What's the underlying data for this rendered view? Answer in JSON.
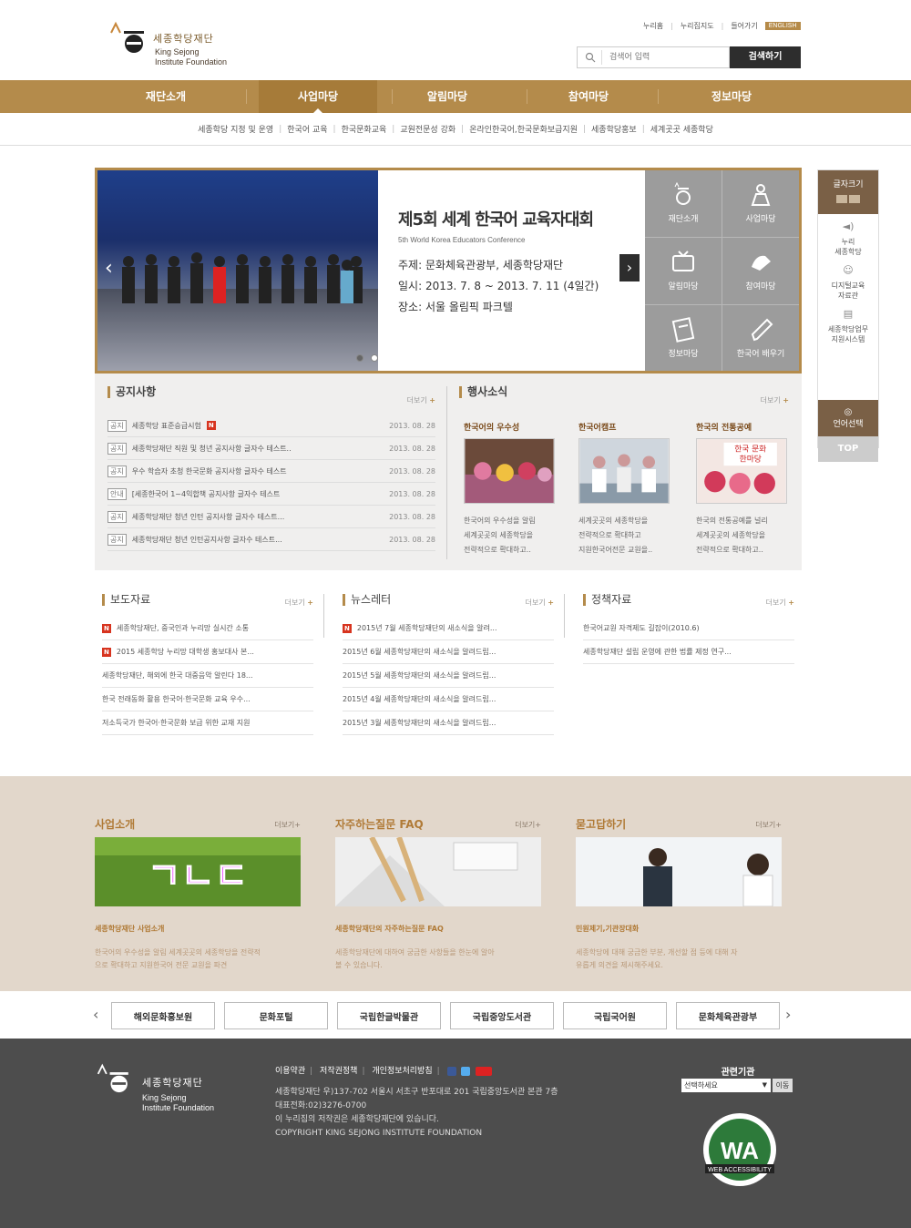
{
  "header": {
    "logo_ko": "세종학당재단",
    "logo_en1": "King Sejong",
    "logo_en2": "Institute Foundation",
    "util": [
      "누리홈",
      "누리집지도",
      "들어가기"
    ],
    "english": "ENGLISH",
    "search_placeholder": "검색어 입력",
    "search_button": "검색하기"
  },
  "gnb": [
    "재단소개",
    "사업마당",
    "알림마당",
    "참여마당",
    "정보마당"
  ],
  "sub_menu": [
    "세종학당 지정 및 운영",
    "한국어 교육",
    "한국문화교육",
    "교원전문성 강화",
    "온라인한국어,한국문화보급지원",
    "세종학당홍보",
    "세계곳곳 세종학당"
  ],
  "visual": {
    "title": "제5회 세계 한국어 교육자대회",
    "subtitle": "5th World Korea Educators Conference",
    "line1": "주제: 문화체육관광부, 세종학당재단",
    "line2": "일시: 2013. 7. 8 ~ 2013. 7. 11 (4일간)",
    "line3": "장소: 서울 올림픽 파크텔",
    "quick": [
      "재단소개",
      "사업마당",
      "알림마당",
      "참여마당",
      "정보마당",
      "한국어 배우기"
    ]
  },
  "notice": {
    "title": "공지사항",
    "more": "더보기",
    "rows": [
      {
        "tag": "공지",
        "text": "세종학당 표준승급시험",
        "date": "2013. 08. 28",
        "new": "N"
      },
      {
        "tag": "공지",
        "text": "세종학당재단 직원 및 청년 공지사항 글자수 테스트..",
        "date": "2013. 08. 28"
      },
      {
        "tag": "공지",
        "text": "우수 학습자 초청 한국문화 공지사항 글자수 테스트",
        "date": "2013. 08. 28"
      },
      {
        "tag": "안내",
        "text": "[세종한국어 1~4익합책  공지사항 글자수 테스트",
        "date": "2013. 08. 28"
      },
      {
        "tag": "공지",
        "text": "세종학당재단 청년 인턴 공지사항 글자수 테스트...",
        "date": "2013. 08. 28"
      },
      {
        "tag": "공지",
        "text": "세종학당재단 청년 인턴공지사항 글자수 테스트...",
        "date": "2013. 08. 28"
      }
    ]
  },
  "events": {
    "title": "행사소식",
    "more": "더보기",
    "cards": [
      {
        "title": "한국어의 우수성",
        "d1": "한국어의 우수성을 알림",
        "d2": "세계곳곳의 세종학당을",
        "d3": "전략적으로 확대하고.."
      },
      {
        "title": "한국어캠프",
        "d1": "세계곳곳의 세종학당을",
        "d2": "전략적으로 확대하고",
        "d3": "지원한국어전문 교원을.."
      },
      {
        "title": "한국의 전통공예",
        "d1": "한국의 전통공예를 널리",
        "d2": "세계곳곳의 세종학당을",
        "d3": "전략적으로 확대하고.."
      }
    ],
    "card3_img_text1": "한국 문화",
    "card3_img_text2": "한마당"
  },
  "press": {
    "title": "보도자료",
    "more": "더보기",
    "rows": [
      {
        "new": "N",
        "text": "세종학당재단, 중국인과 누리망 실시간 소통"
      },
      {
        "new": "N",
        "text": "2015 세종학당 누리망 대학생 홍보대사 본..."
      },
      {
        "text": "세종학당재단, 해외에 한국 대중음악 알린다 18..."
      },
      {
        "text": "한국 전래동화 활용 한국어·한국문화 교육 우수..."
      },
      {
        "text": "저소득국가 한국어·한국문화 보급 위한 교재 지원"
      }
    ]
  },
  "newsletter": {
    "title": "뉴스레터",
    "more": "더보기",
    "rows": [
      {
        "new": "N",
        "text": "2015년 7월 세종학당재단의 새소식을 알려..."
      },
      {
        "text": "2015년 6월 세종학당재단의 새소식을 알려드립..."
      },
      {
        "text": "2015년 5월 세종학당재단의 새소식을 알려드립..."
      },
      {
        "text": "2015년 4월 세종학당재단의 새소식을 알려드립..."
      },
      {
        "text": "2015년 3월 세종학당재단의 새소식을 알려드립..."
      }
    ]
  },
  "policy": {
    "title": "정책자료",
    "more": "더보기",
    "rows": [
      {
        "text": "한국어교원 자격제도 길잡이(2010.6)"
      },
      {
        "text": "세종학당재단 설립 운영에 관한 법률 제정 연구..."
      }
    ]
  },
  "band": [
    {
      "title": "사업소개",
      "more": "더보기+",
      "img_text": "ㄱㄴㄷ",
      "sub": "세종학당재단 사업소개",
      "d1": "한국어의 우수성을 알림 세계곳곳의 세종학당을 전략적",
      "d2": "으로 확대하고 지원한국어 전문 교원을 파견"
    },
    {
      "title": "자주하는질문 FAQ",
      "more": "더보기+",
      "sub": "세종학당재단의 자주하는질문 FAQ",
      "d1": "세종학당재단에 대하여 궁금한 사항들을 한눈에 알아",
      "d2": "볼 수 있습니다."
    },
    {
      "title": "묻고답하기",
      "more": "더보기+",
      "sub": "민원제기,기관장대화",
      "d1": "세종학당에 대해 궁금한 부분, 개선할 점 등에 대해 자",
      "d2": "유롭게 의견을 제시해주세요."
    }
  ],
  "partners": [
    "해외문화홍보원",
    "문화포털",
    "국립한글박물관",
    "국립중앙도서관",
    "국립국어원",
    "문화체육관광부"
  ],
  "footer": {
    "links": [
      "이용약관",
      "저작권정책",
      "개인정보처리방침"
    ],
    "addr1": "세종학당재단 우)137-702 서울시 서초구 반포대로 201 국립중앙도서관 본관 7층",
    "addr2": "대표전화:02)3276-0700",
    "addr3": "이 누리집의 저작권은 세종학당재단에 있습니다.",
    "addr4": "COPYRIGHT KING SEJONG INSTITUTE FOUNDATION",
    "related_title": "관련기관",
    "related_select": "선택하세요",
    "related_go": "이동",
    "wa_text": "WEB ACCESSIBILITY"
  },
  "side": {
    "fontsize": "글자크기",
    "items": [
      {
        "l1": "누리",
        "l2": "세종학당"
      },
      {
        "l1": "디지털교육",
        "l2": "자료관"
      },
      {
        "l1": "세종학당업무",
        "l2": "지원시스템"
      }
    ],
    "lang": "언어선택",
    "top": "TOP"
  },
  "colors": {
    "brand": "#b48b4b",
    "dark": "#2d2d2d",
    "new_badge": "#d7341f",
    "band": "#e2d7cb",
    "footer": "#4d4d4d"
  }
}
